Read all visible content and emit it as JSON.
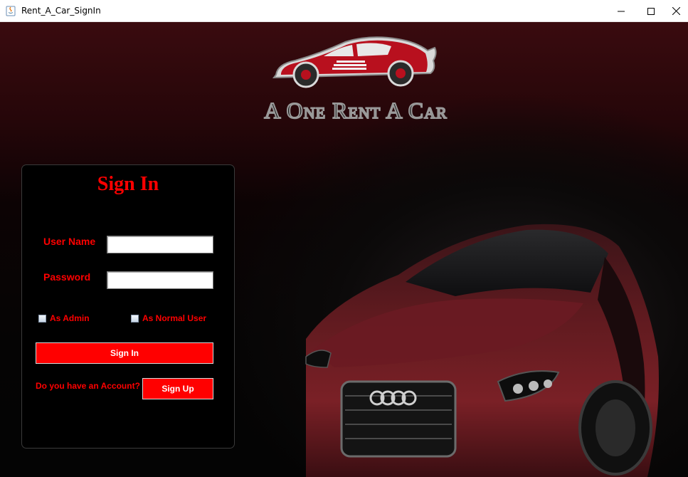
{
  "window": {
    "title": "Rent_A_Car_SignIn"
  },
  "brand": {
    "logo_text": "A One Rent A Car",
    "accent": "#ff0000"
  },
  "signin": {
    "title": "Sign In",
    "username_label": "User Name",
    "username_value": "",
    "password_label": "Password",
    "password_value": "",
    "admin_option": "As Admin",
    "normal_option": "As Normal User",
    "admin_checked": false,
    "normal_checked": false,
    "signin_button": "Sign In",
    "account_question": "Do you have an Account?",
    "signup_button": "Sign Up"
  },
  "icons": {
    "app": "java-app-icon",
    "minimize": "minimize-icon",
    "maximize": "maximize-icon",
    "close": "close-icon"
  }
}
